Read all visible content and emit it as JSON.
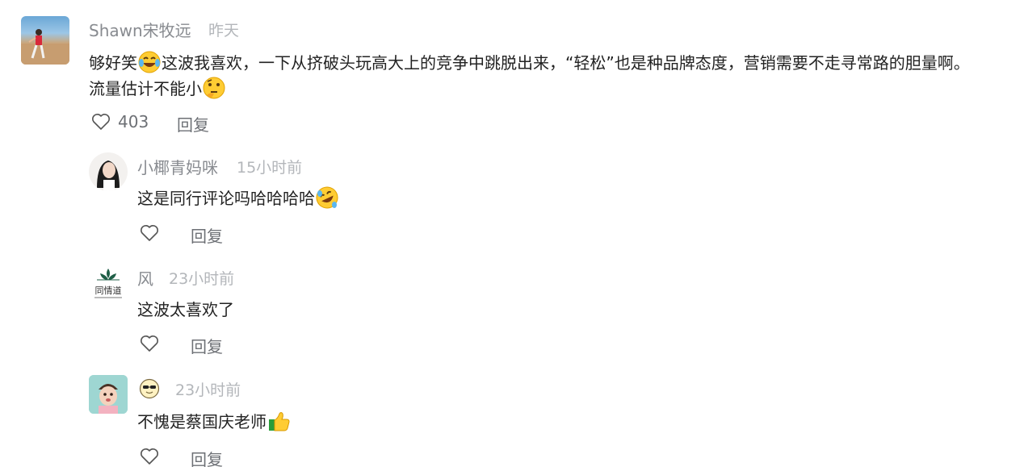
{
  "comment": {
    "user": "Shawn宋牧远",
    "time": "昨天",
    "text_a": "够好笑",
    "text_b": "这波我喜欢，一下从挤破头玩高大上的竞争中跳脱出来，“轻松”也是种品牌态度，营销需要不走寻常路的胆量啊。",
    "text_c": "流量估计不能小",
    "likes": "403",
    "reply_label": "回复",
    "emoji_a": "laughing-tears-emoji",
    "emoji_b": "thinking-emoji"
  },
  "replies": [
    {
      "user": "小椰青妈咪",
      "time": "15小时前",
      "text": "这是同行评论吗哈哈哈哈",
      "emoji": "rolling-laugh-emoji",
      "reply_label": "回复"
    },
    {
      "user": "风",
      "time": "23小时前",
      "text": "这波太喜欢了",
      "avatar_text": "同情道",
      "reply_label": "回复"
    },
    {
      "user_emoji": "sunglasses-emoji",
      "time": "23小时前",
      "text": "不愧是蔡国庆老师",
      "emoji": "thumbs-up-emoji",
      "reply_label": "回复"
    }
  ]
}
